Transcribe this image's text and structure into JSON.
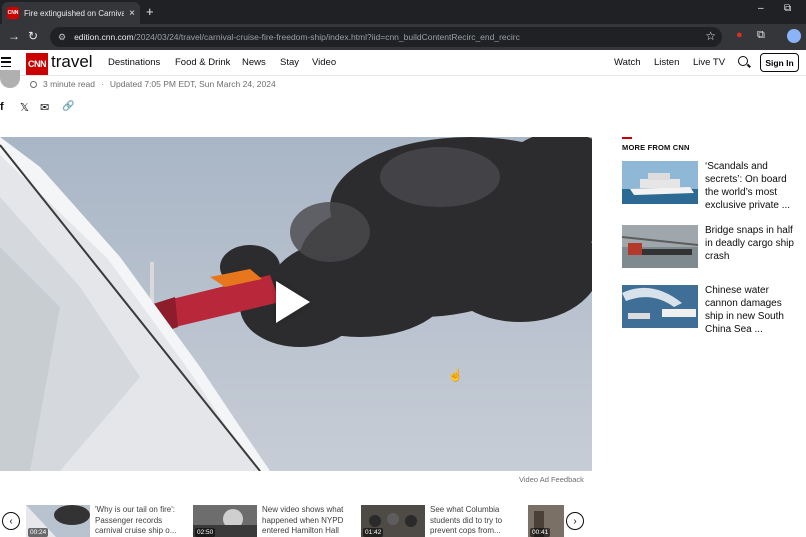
{
  "browser": {
    "tab_title": "Fire extinguished on Carnival Fr",
    "tab_favicon_text": "CNN",
    "new_tab": "+",
    "close": "×",
    "window_min": "–",
    "window_max": "⧉",
    "url_host": "edition.cnn.com",
    "url_path": "/2024/03/24/travel/carnival-cruise-fire-freedom-ship/index.html?iid=cnn_buildContentRecirc_end_recirc"
  },
  "header": {
    "logo": "CNN",
    "section": "travel",
    "nav": [
      "Destinations",
      "Food & Drink",
      "News",
      "Stay",
      "Video"
    ],
    "right_links": [
      "Watch",
      "Listen",
      "Live TV"
    ],
    "signin": "Sign In"
  },
  "byline": {
    "read_time": "3 minute read",
    "updated": "Updated 7:05 PM EDT, Sun March 24, 2024"
  },
  "share": {
    "facebook": "f",
    "x": "𝕏",
    "email": "✉",
    "link": "🔗"
  },
  "video": {
    "feedback": "Video Ad Feedback"
  },
  "sidebar": {
    "title": "MORE FROM CNN",
    "cards": [
      {
        "title": "‘Scandals and secrets’: On board the world’s most exclusive private ..."
      },
      {
        "title": "Bridge snaps in half in deadly cargo ship crash"
      },
      {
        "title": "Chinese water cannon damages ship in new South China Sea ..."
      }
    ]
  },
  "carousel": {
    "prev": "‹",
    "next": "›",
    "items": [
      {
        "title": "'Why is our tail on fire': Passenger records carnival cruise ship o...",
        "duration": "00:24"
      },
      {
        "title": "New video shows what happened when NYPD entered Hamilton Hall",
        "duration": "02:50"
      },
      {
        "title": "See what Columbia students did to try to prevent cops from...",
        "duration": "01:42"
      },
      {
        "title": "",
        "duration": "00:41"
      }
    ]
  },
  "colors": {
    "brand": "#cc0000",
    "chrome_dark": "#202124"
  }
}
